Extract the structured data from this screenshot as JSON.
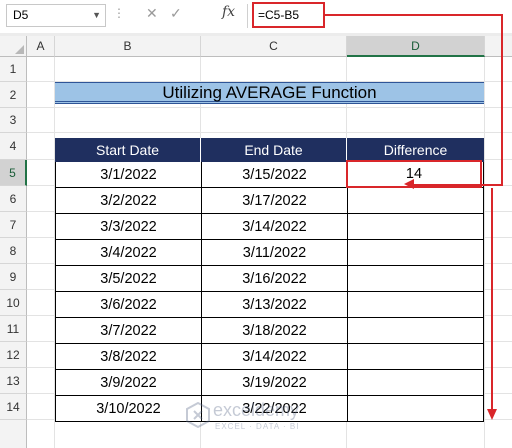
{
  "formula_bar": {
    "name_box": "D5",
    "formula": "=C5-B5",
    "fx_label": "fx",
    "icons": [
      "dropdown-arrow-icon",
      "more-options-icon",
      "cancel-icon",
      "enter-icon",
      "insert-function-icon"
    ]
  },
  "sheet": {
    "columns": [
      "A",
      "B",
      "C",
      "D"
    ],
    "rows": [
      "1",
      "2",
      "3",
      "4",
      "5",
      "6",
      "7",
      "8",
      "9",
      "10",
      "11",
      "12",
      "13",
      "14"
    ],
    "selected_cell": "D5"
  },
  "title": "Utilizing AVERAGE Function",
  "table": {
    "headers": [
      "Start  Date",
      "End Date",
      "Difference"
    ],
    "rows": [
      [
        "3/1/2022",
        "3/15/2022",
        "14"
      ],
      [
        "3/2/2022",
        "3/17/2022",
        ""
      ],
      [
        "3/3/2022",
        "3/14/2022",
        ""
      ],
      [
        "3/4/2022",
        "3/11/2022",
        ""
      ],
      [
        "3/5/2022",
        "3/16/2022",
        ""
      ],
      [
        "3/6/2022",
        "3/13/2022",
        ""
      ],
      [
        "3/7/2022",
        "3/18/2022",
        ""
      ],
      [
        "3/8/2022",
        "3/14/2022",
        ""
      ],
      [
        "3/9/2022",
        "3/19/2022",
        ""
      ],
      [
        "3/10/2022",
        "3/22/2022",
        ""
      ]
    ]
  },
  "watermark": {
    "name": "exceldemy",
    "tagline": "EXCEL · DATA · BI"
  },
  "colors": {
    "header_fill": "#1f2f5f",
    "title_fill": "#9dc3e6",
    "annotation_red": "#d9262a",
    "selection_green": "#217346"
  }
}
